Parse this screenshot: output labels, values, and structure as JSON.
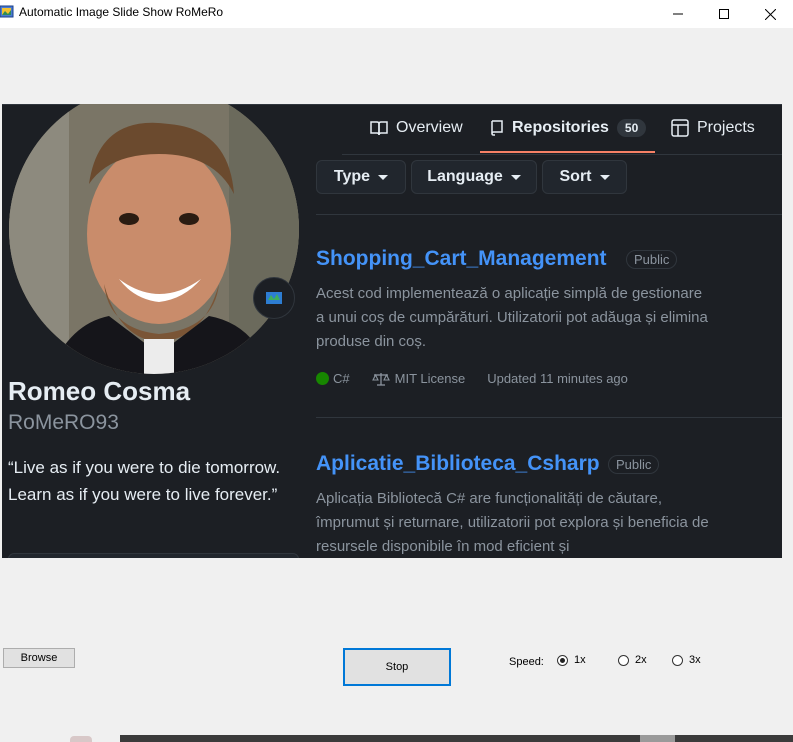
{
  "window": {
    "title": "Automatic Image Slide Show  RoMeRo",
    "minimize_icon": "minimize-icon",
    "maximize_icon": "maximize-icon",
    "close_icon": "close-icon"
  },
  "slide": {
    "nav": {
      "overview_label": "Overview",
      "repositories_label": "Repositories",
      "repositories_count": "50",
      "projects_label": "Projects"
    },
    "profile": {
      "name": "Romeo Cosma",
      "login": "RoMeRO93",
      "bio": "“Live as if you were to die tomorrow. Learn as if you were to live forever.”"
    },
    "filters": {
      "type_label": "Type",
      "language_label": "Language",
      "sort_label": "Sort"
    },
    "repos": [
      {
        "name": "Shopping_Cart_Management",
        "visibility": "Public",
        "description": "Acest cod implementează o aplicație simplă de gestionare a unui coș de cumpărături. Utilizatorii pot adăuga și elimina produse din coș.",
        "language": "C#",
        "language_color": "#178600",
        "license": "MIT License",
        "updated": "Updated 11 minutes ago"
      },
      {
        "name": "Aplicatie_Biblioteca_Csharp",
        "visibility": "Public",
        "description": "Aplicația Bibliotecă C# are funcționalități de căutare, împrumut și returnare, utilizatorii pot explora și beneficia de resursele disponibile în mod eficient și"
      }
    ]
  },
  "controls": {
    "browse_label": "Browse",
    "stop_label": "Stop",
    "speed_label": "Speed:",
    "speed_options": [
      "1x",
      "2x",
      "3x"
    ],
    "speed_selected": "1x"
  },
  "colors": {
    "accent": "#0078d7",
    "link": "#4493f8",
    "background_dark": "#1c1f24"
  }
}
